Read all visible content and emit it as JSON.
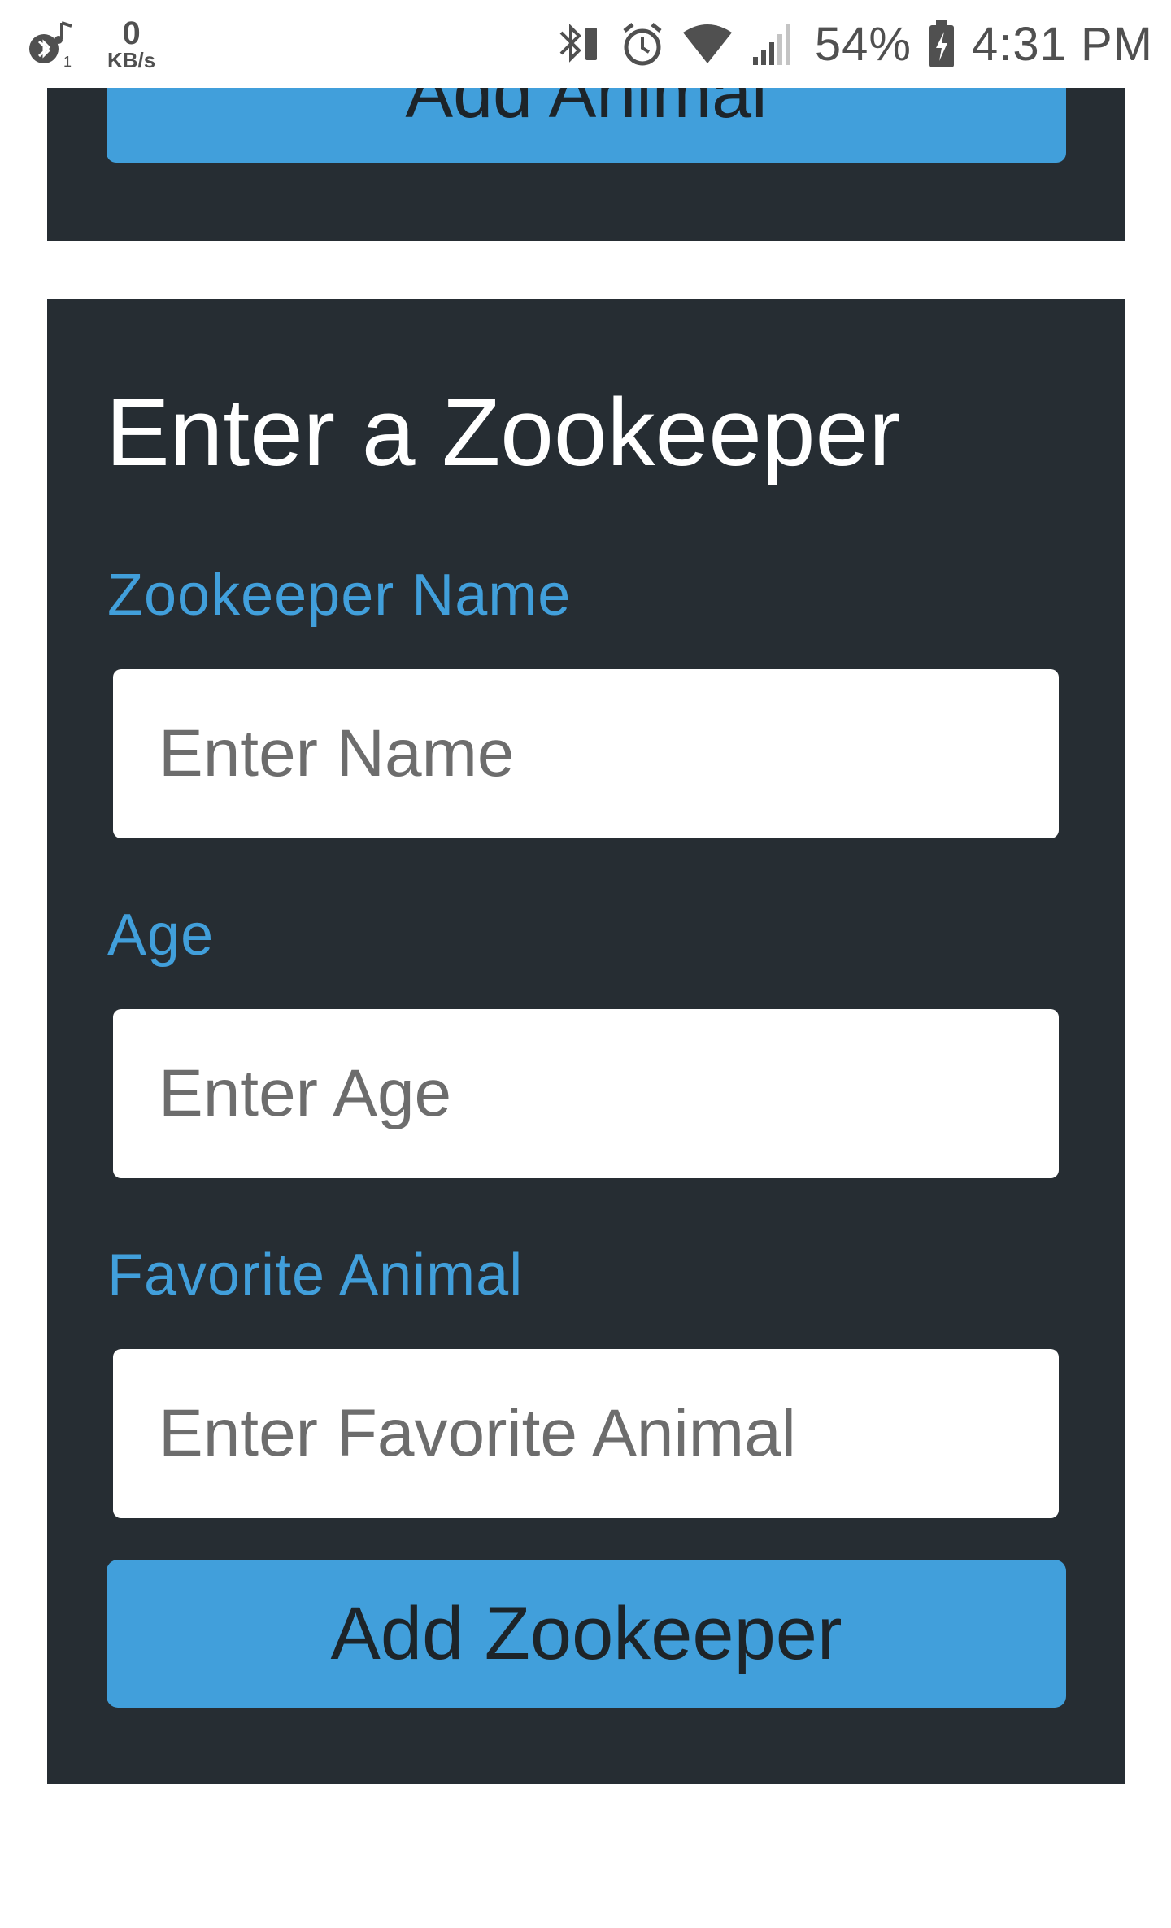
{
  "status_bar": {
    "net_speed_value": "0",
    "net_speed_unit": "KB/s",
    "battery_percent": "54%",
    "time": "4:31 PM",
    "icons": [
      "bluetooth-music-icon",
      "bluetooth-icon",
      "alarm-icon",
      "wifi-icon",
      "signal-icon",
      "battery-charging-icon"
    ]
  },
  "animal_form": {
    "submit_label": "Add Animal"
  },
  "zookeeper_form": {
    "title": "Enter a Zookeeper",
    "name_label": "Zookeeper Name",
    "name_placeholder": "Enter Name",
    "age_label": "Age",
    "age_placeholder": "Enter Age",
    "animal_label": "Favorite Animal",
    "animal_placeholder": "Enter Favorite Animal",
    "submit_label": "Add Zookeeper"
  },
  "colors": {
    "card_background": "#262d33",
    "accent": "#419fdb",
    "page_background": "#ffffff"
  }
}
